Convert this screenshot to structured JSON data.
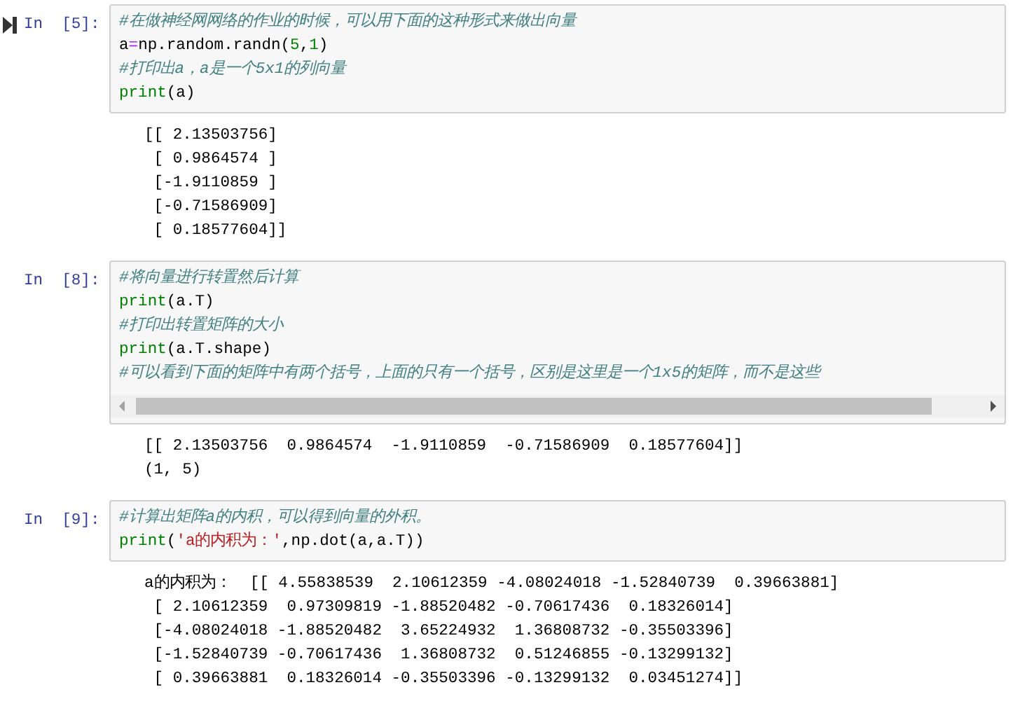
{
  "cells": [
    {
      "prompt": "In  [5]:",
      "run_marker": true,
      "scrollable": false,
      "code": [
        [
          {
            "kind": "comment",
            "text": "#在做神经网网络的作业的时候，可以用下面的这种形式来做出向量"
          }
        ],
        [
          {
            "kind": "plain",
            "text": "a"
          },
          {
            "kind": "operator",
            "text": "="
          },
          {
            "kind": "plain",
            "text": "np.random.randn("
          },
          {
            "kind": "number",
            "text": "5"
          },
          {
            "kind": "plain",
            "text": ","
          },
          {
            "kind": "number",
            "text": "1"
          },
          {
            "kind": "plain",
            "text": ")"
          }
        ],
        [
          {
            "kind": "comment",
            "text": "#打印出a，a是一个5x1的列向量"
          }
        ],
        [
          {
            "kind": "builtin",
            "text": "print"
          },
          {
            "kind": "plain",
            "text": "(a)"
          }
        ]
      ],
      "output": [
        "[[ 2.13503756]",
        " [ 0.9864574 ]",
        " [-1.9110859 ]",
        " [-0.71586909]",
        " [ 0.18577604]]"
      ]
    },
    {
      "prompt": "In  [8]:",
      "run_marker": false,
      "scrollable": true,
      "code": [
        [
          {
            "kind": "comment",
            "text": "#将向量进行转置然后计算"
          }
        ],
        [
          {
            "kind": "builtin",
            "text": "print"
          },
          {
            "kind": "plain",
            "text": "(a.T)"
          }
        ],
        [
          {
            "kind": "comment",
            "text": "#打印出转置矩阵的大小"
          }
        ],
        [
          {
            "kind": "builtin",
            "text": "print"
          },
          {
            "kind": "plain",
            "text": "(a.T.shape)"
          }
        ],
        [
          {
            "kind": "comment",
            "text": "#可以看到下面的矩阵中有两个括号，上面的只有一个括号，区别是这里是一个1x5的矩阵，而不是这些"
          }
        ]
      ],
      "output": [
        "[[ 2.13503756  0.9864574  -1.9110859  -0.71586909  0.18577604]]",
        "(1, 5)"
      ]
    },
    {
      "prompt": "In  [9]:",
      "run_marker": false,
      "scrollable": false,
      "code": [
        [
          {
            "kind": "comment",
            "text": "#计算出矩阵a的内积，可以得到向量的外积。"
          }
        ],
        [
          {
            "kind": "builtin",
            "text": "print"
          },
          {
            "kind": "plain",
            "text": "("
          },
          {
            "kind": "string",
            "text": "'a的内积为：'"
          },
          {
            "kind": "plain",
            "text": ",np.dot(a,a.T))"
          }
        ]
      ],
      "output": [
        "a的内积为：  [[ 4.55838539  2.10612359 -4.08024018 -1.52840739  0.39663881]",
        " [ 2.10612359  0.97309819 -1.88520482 -0.70617436  0.18326014]",
        " [-4.08024018 -1.88520482  3.65224932  1.36808732 -0.35503396]",
        " [-1.52840739 -0.70617436  1.36808732  0.51246855 -0.13299132]",
        " [ 0.39663881  0.18326014 -0.35503396 -0.13299132  0.03451274]]"
      ]
    }
  ]
}
